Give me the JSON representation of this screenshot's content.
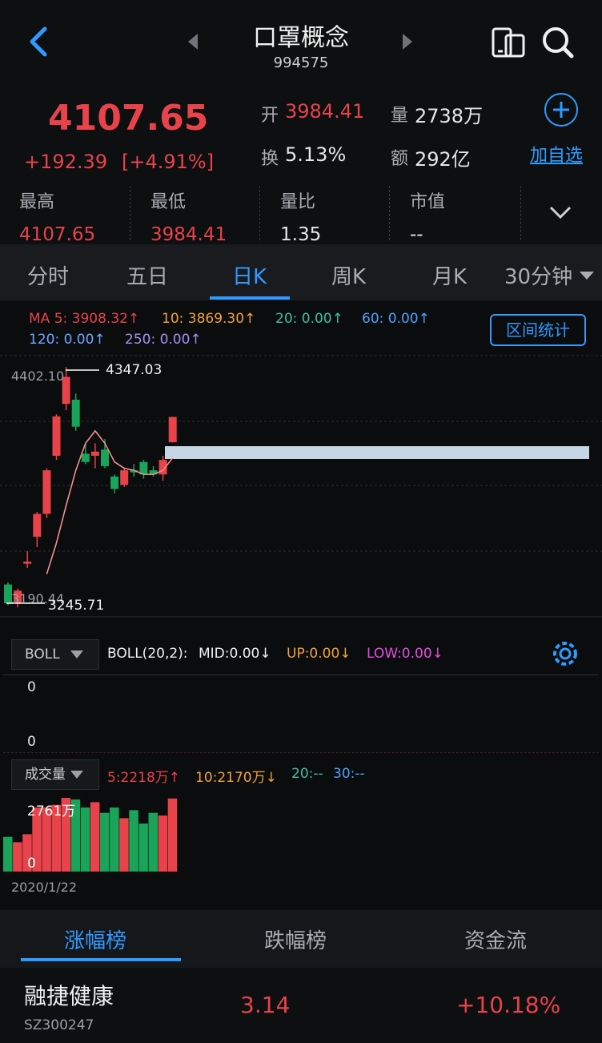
{
  "header": {
    "title": "口罩概念",
    "code": "994575",
    "back_icon": "chevron-left-icon",
    "prev_icon": "triangle-left-icon",
    "next_icon": "triangle-right-icon",
    "actions": [
      "device-switch-icon",
      "search-icon"
    ]
  },
  "quote": {
    "price": "4107.65",
    "change": "+192.39",
    "change_pct": "[+4.91%]",
    "open_label": "开",
    "open": "3984.41",
    "vol_label": "量",
    "vol": "2738万",
    "turnover_label": "换",
    "turnover": "5.13%",
    "amount_label": "额",
    "amount": "292亿",
    "add_watch": "加自选"
  },
  "stats": [
    {
      "label": "最高",
      "value": "4107.65"
    },
    {
      "label": "最低",
      "value": "3984.41"
    },
    {
      "label": "量比",
      "value": "1.35"
    },
    {
      "label": "市值",
      "value": "--"
    }
  ],
  "tabs": [
    "分时",
    "五日",
    "日K",
    "周K",
    "月K",
    "30分钟"
  ],
  "active_tab": "日K",
  "ma": {
    "ma5": "MA 5: 3908.32↑",
    "ma10": "10: 3869.30↑",
    "ma20": "20: 0.00↑",
    "ma60": "60: 0.00↑",
    "ma120": "120: 0.00↑",
    "ma250": "250: 0.00↑",
    "range_btn": "区间统计"
  },
  "kline": {
    "high_label": "4402.10",
    "top_mark": "4347.03",
    "low_label": "3190.44",
    "bottom_mark": "3245.71"
  },
  "boll": {
    "selector": "BOLL",
    "params": "BOLL(20,2):",
    "mid": "MID:0.00↓",
    "up": "UP:0.00↓",
    "low": "LOW:0.00↓",
    "top_val": "0",
    "bot_val": "0"
  },
  "volume": {
    "selector": "成交量",
    "v5": "5:2218万↑",
    "v10": "10:2170万↓",
    "v20": "20:--",
    "v30": "30:--",
    "max_label": "2761万",
    "zero": "0",
    "date": "2020/1/22"
  },
  "bottom_tabs": [
    "涨幅榜",
    "跌幅榜",
    "资金流"
  ],
  "list": [
    {
      "name": "融捷健康",
      "code": "SZ300247",
      "price": "3.14",
      "pct": "+10.18%"
    }
  ],
  "colors": {
    "up": "#e8434a",
    "down": "#19a45a",
    "accent": "#2f9bff"
  },
  "chart_data": {
    "type": "candlestick",
    "candles": [
      {
        "o": 3300,
        "h": 3310,
        "l": 3200,
        "c": 3210
      },
      {
        "o": 3210,
        "h": 3280,
        "l": 3190,
        "c": 3270
      },
      {
        "o": 3400,
        "h": 3460,
        "l": 3380,
        "c": 3410
      },
      {
        "o": 3530,
        "h": 3650,
        "l": 3480,
        "c": 3640
      },
      {
        "o": 3640,
        "h": 3860,
        "l": 3620,
        "c": 3850
      },
      {
        "o": 3920,
        "h": 4120,
        "l": 3900,
        "c": 4110
      },
      {
        "o": 4170,
        "h": 4347,
        "l": 4140,
        "c": 4300
      },
      {
        "o": 4190,
        "h": 4220,
        "l": 4040,
        "c": 4060
      },
      {
        "o": 3930,
        "h": 3980,
        "l": 3880,
        "c": 3890
      },
      {
        "o": 3920,
        "h": 3980,
        "l": 3860,
        "c": 3940
      },
      {
        "o": 3950,
        "h": 4000,
        "l": 3860,
        "c": 3870
      },
      {
        "o": 3820,
        "h": 3830,
        "l": 3740,
        "c": 3760
      },
      {
        "o": 3780,
        "h": 3860,
        "l": 3770,
        "c": 3850
      },
      {
        "o": 3850,
        "h": 3880,
        "l": 3820,
        "c": 3840
      },
      {
        "o": 3890,
        "h": 3900,
        "l": 3810,
        "c": 3830
      },
      {
        "o": 3850,
        "h": 3870,
        "l": 3820,
        "c": 3830
      },
      {
        "o": 3830,
        "h": 3920,
        "l": 3800,
        "c": 3900
      },
      {
        "o": 3985,
        "h": 4108,
        "l": 3984,
        "c": 4107
      }
    ],
    "ma_line": [
      null,
      null,
      null,
      null,
      3350,
      3500,
      3680,
      3850,
      3980,
      4040,
      3980,
      3890,
      3860,
      3850,
      3830,
      3830,
      3850,
      3910
    ],
    "volumes": [
      1300,
      1100,
      1400,
      2400,
      2400,
      2500,
      2761,
      2700,
      2400,
      2600,
      2200,
      2400,
      2000,
      2300,
      1800,
      2200,
      2100,
      2738
    ],
    "ylim": [
      3190.44,
      4402.1
    ]
  }
}
